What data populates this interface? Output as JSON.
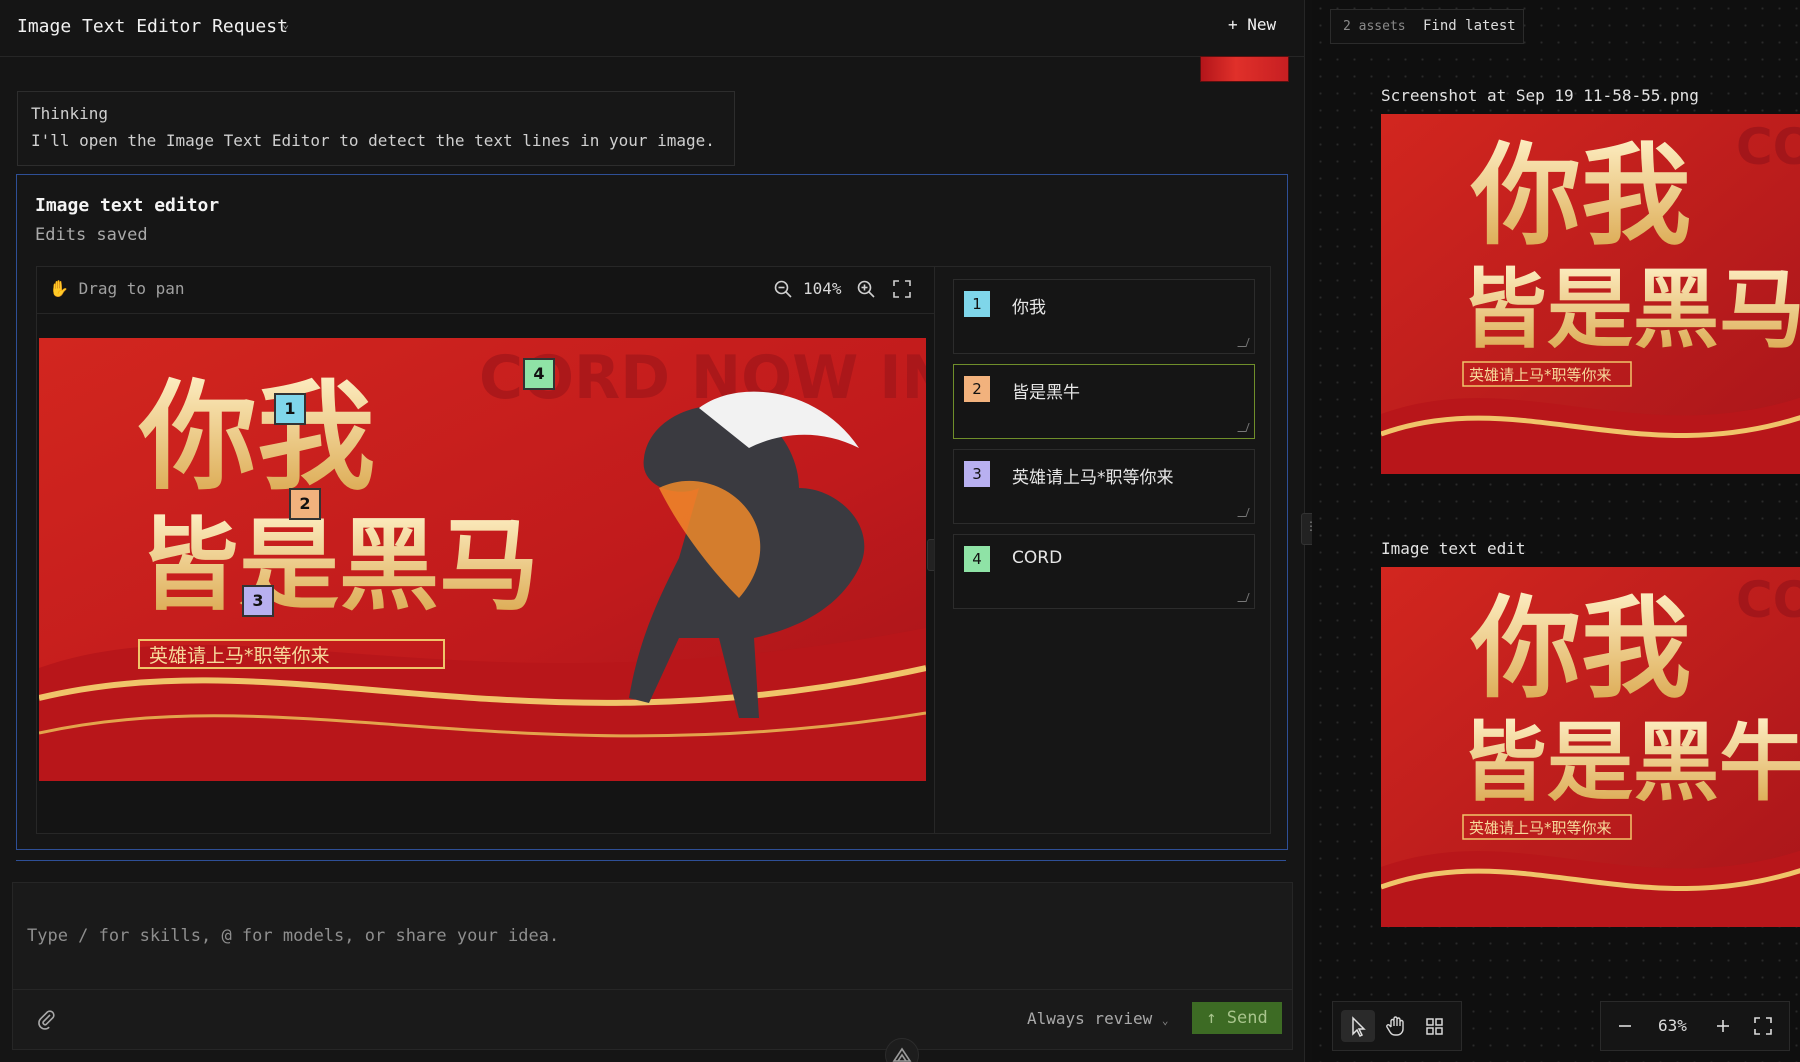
{
  "header": {
    "title": "Image Text Editor Request",
    "new_label": "+ New"
  },
  "thinking": {
    "title": "Thinking",
    "text": "I'll open the Image Text Editor to detect the text lines in your image."
  },
  "editor": {
    "title": "Image text editor",
    "status": "Edits saved",
    "pan_hint": "Drag to pan",
    "zoom": "104%",
    "image": {
      "text_main_top": "你我",
      "text_main_bottom": "皆是黑马",
      "text_subtitle": "英雄请上马*职等你来",
      "text_watermark": "CORD NOW INVITE"
    },
    "markers": [
      "1",
      "2",
      "3",
      "4"
    ],
    "lines": [
      {
        "num": "1",
        "text": "你我",
        "color": "#7fd6ea"
      },
      {
        "num": "2",
        "text": "皆是黑牛",
        "color": "#f2b27d"
      },
      {
        "num": "3",
        "text": "英雄请上马*职等你来",
        "color": "#b8b0f0"
      },
      {
        "num": "4",
        "text": "CORD",
        "color": "#8fe3a6"
      }
    ]
  },
  "composer": {
    "placeholder": "Type / for skills, @ for models, or share your idea.",
    "review_label": "Always review",
    "send_label": "↑ Send"
  },
  "right_panel": {
    "assets_count": "2 assets",
    "find_latest": "Find latest",
    "asset1": {
      "label": "Screenshot at Sep 19 11-58-55.png",
      "text_top": "你我",
      "text_bottom": "皆是黑马",
      "text_sub": "英雄请上马*职等你来",
      "text_wm": "CO"
    },
    "asset2": {
      "label": "Image text edit",
      "text_top": "你我",
      "text_bottom": "皆是黑牛",
      "text_sub": "英雄请上马*职等你来",
      "text_wm": "CO"
    },
    "zoom": "63%"
  },
  "colors": {
    "accent_border": "#2e4f96",
    "send_bg": "#3d6b24",
    "banner_red": "#c8201f",
    "banner_gold": "#f0d69a"
  }
}
